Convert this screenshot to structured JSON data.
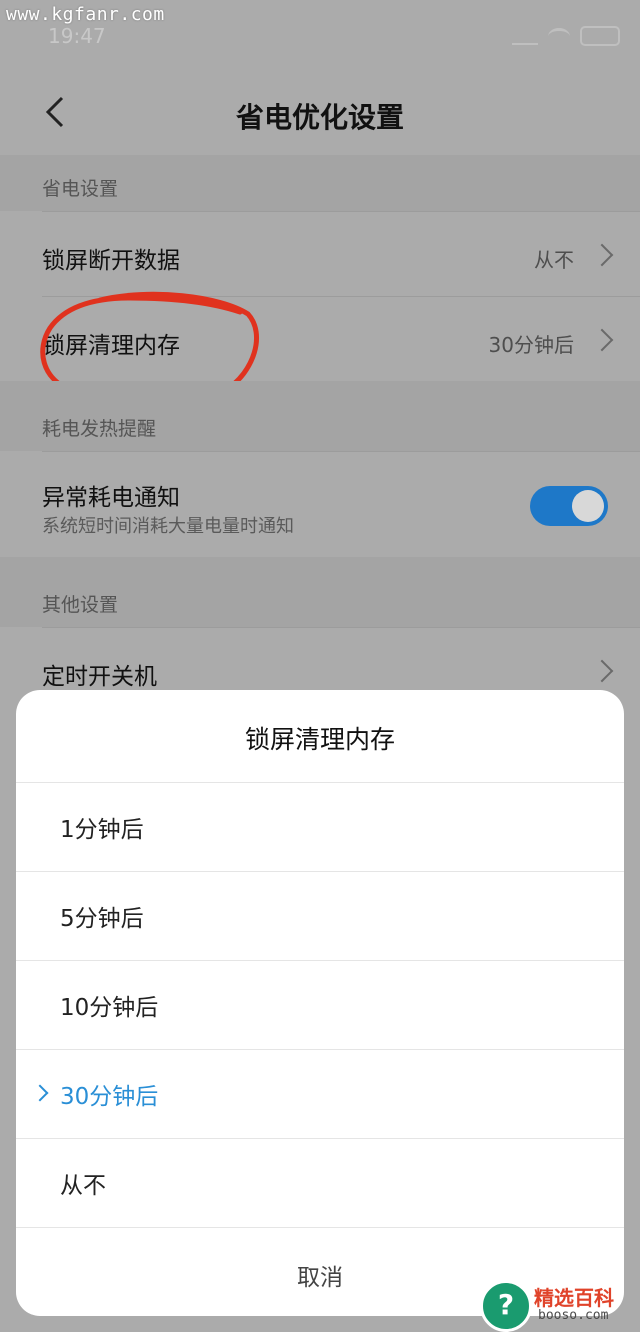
{
  "watermark": "www.kgfanr.com",
  "statusbar": {
    "time": "19:47"
  },
  "header": {
    "title": "省电优化设置"
  },
  "sections": {
    "power": {
      "label": "省电设置",
      "items": [
        {
          "title": "锁屏断开数据",
          "value": "从不"
        },
        {
          "title": "锁屏清理内存",
          "value": "30分钟后"
        }
      ]
    },
    "heat": {
      "label": "耗电发热提醒",
      "item": {
        "title": "异常耗电通知",
        "subtitle": "系统短时间消耗大量电量时通知",
        "enabled": true
      }
    },
    "other": {
      "label": "其他设置",
      "item": {
        "title": "定时开关机"
      }
    }
  },
  "dialog": {
    "title": "锁屏清理内存",
    "options": [
      "1分钟后",
      "5分钟后",
      "10分钟后",
      "30分钟后",
      "从不"
    ],
    "selected_index": 3,
    "cancel": "取消"
  },
  "logo": {
    "text": "精选百科",
    "sub": "booso.com"
  },
  "colors": {
    "accent": "#2a8fd6",
    "toggle_on": "#1e78c8",
    "annotation": "#e0321e"
  }
}
